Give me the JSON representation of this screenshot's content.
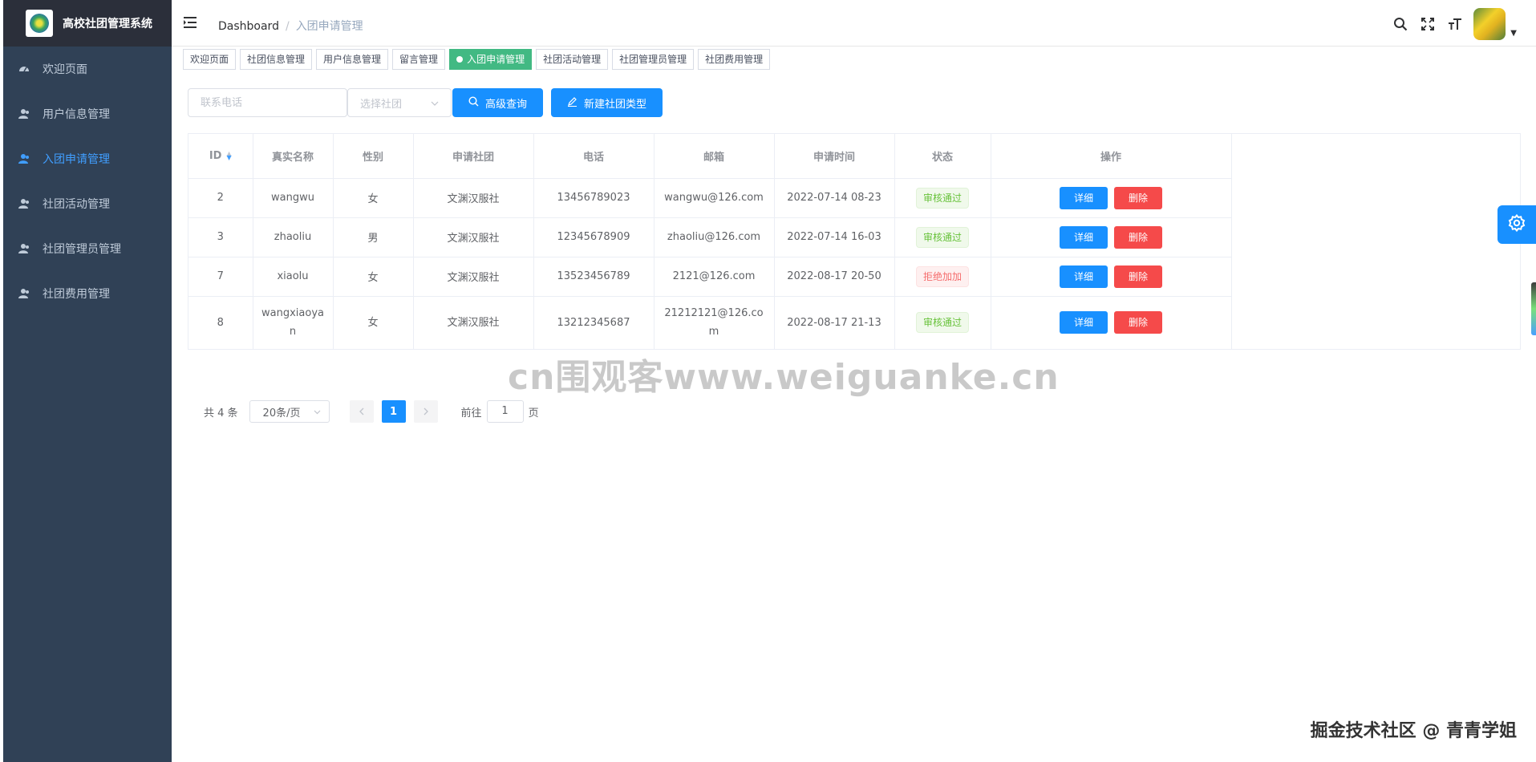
{
  "app": {
    "title": "高校社团管理系统"
  },
  "sidebar": {
    "items": [
      {
        "label": "欢迎页面",
        "icon": "dashboard-icon",
        "active": false
      },
      {
        "label": "用户信息管理",
        "icon": "user-icon",
        "active": false
      },
      {
        "label": "入团申请管理",
        "icon": "user-icon",
        "active": true
      },
      {
        "label": "社团活动管理",
        "icon": "user-icon",
        "active": false
      },
      {
        "label": "社团管理员管理",
        "icon": "user-icon",
        "active": false
      },
      {
        "label": "社团费用管理",
        "icon": "user-icon",
        "active": false
      }
    ]
  },
  "header": {
    "breadcrumb": [
      "Dashboard",
      "入团申请管理"
    ],
    "icons": [
      "search-icon",
      "fullscreen-icon",
      "font-size-icon",
      "avatar",
      "caret-down-icon"
    ]
  },
  "tags": [
    {
      "label": "欢迎页面",
      "active": false
    },
    {
      "label": "社团信息管理",
      "active": false
    },
    {
      "label": "用户信息管理",
      "active": false
    },
    {
      "label": "留言管理",
      "active": false
    },
    {
      "label": "入团申请管理",
      "active": true
    },
    {
      "label": "社团活动管理",
      "active": false
    },
    {
      "label": "社团管理员管理",
      "active": false
    },
    {
      "label": "社团费用管理",
      "active": false
    }
  ],
  "filters": {
    "phone_placeholder": "联系电话",
    "club_placeholder": "选择社团",
    "search_button": "高级查询",
    "new_button": "新建社团类型"
  },
  "table": {
    "headers": [
      "ID",
      "真实名称",
      "性别",
      "申请社团",
      "电话",
      "邮箱",
      "申请时间",
      "状态",
      "操作"
    ],
    "rows": [
      {
        "id": "2",
        "name": "wangwu",
        "gender": "女",
        "club": "文渊汉服社",
        "phone": "13456789023",
        "email": "wangwu@126.com",
        "time": "2022-07-14 08-23",
        "status": "审核通过",
        "status_type": "ok"
      },
      {
        "id": "3",
        "name": "zhaoliu",
        "gender": "男",
        "club": "文渊汉服社",
        "phone": "12345678909",
        "email": "zhaoliu@126.com",
        "time": "2022-07-14 16-03",
        "status": "审核通过",
        "status_type": "ok"
      },
      {
        "id": "7",
        "name": "xiaolu",
        "gender": "女",
        "club": "文渊汉服社",
        "phone": "13523456789",
        "email": "2121@126.com",
        "time": "2022-08-17 20-50",
        "status": "拒绝加加",
        "status_type": "rej"
      },
      {
        "id": "8",
        "name": "wangxiaoyan",
        "gender": "女",
        "club": "文渊汉服社",
        "phone": "13212345687",
        "email": "21212121@126.com",
        "time": "2022-08-17 21-13",
        "status": "审核通过",
        "status_type": "ok"
      }
    ],
    "detail_label": "详细",
    "delete_label": "删除"
  },
  "pagination": {
    "total": "共 4 条",
    "page_size": "20条/页",
    "current_page": "1",
    "goto_prefix": "前往",
    "goto_value": "1",
    "goto_suffix": "页"
  },
  "watermark": "cn围观客www.weiguanke.cn",
  "credit": "掘金技术社区 @ 青青学姐",
  "colors": {
    "sidebar_bg": "#304156",
    "brand_bg": "#2b2f3a",
    "primary": "#1890ff",
    "danger": "#f54a4a",
    "tag_active": "#42b983"
  }
}
